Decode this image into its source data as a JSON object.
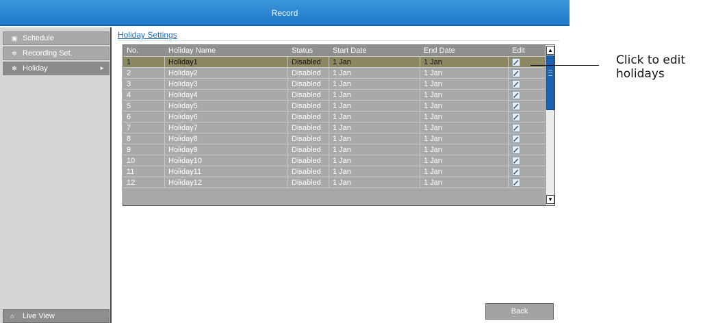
{
  "window": {
    "title": "Record"
  },
  "sidebar": {
    "items": [
      {
        "label": "Schedule",
        "icon": "calendar-icon",
        "active": false
      },
      {
        "label": "Recording Set.",
        "icon": "gear-icon",
        "active": false
      },
      {
        "label": "Holiday",
        "icon": "holiday-icon",
        "active": true,
        "arrow": "►"
      }
    ],
    "live_view": {
      "label": "Live View",
      "icon": "home-icon"
    }
  },
  "main": {
    "section_title": "Holiday Settings",
    "table": {
      "columns": [
        "No.",
        "Holiday Name",
        "Status",
        "Start Date",
        "End Date",
        "Edit"
      ],
      "rows": [
        {
          "no": "1",
          "name": "Holiday1",
          "status": "Disabled",
          "start": "1 Jan",
          "end": "1 Jan"
        },
        {
          "no": "2",
          "name": "Holiday2",
          "status": "Disabled",
          "start": "1 Jan",
          "end": "1 Jan"
        },
        {
          "no": "3",
          "name": "Holiday3",
          "status": "Disabled",
          "start": "1 Jan",
          "end": "1 Jan"
        },
        {
          "no": "4",
          "name": "Holiday4",
          "status": "Disabled",
          "start": "1 Jan",
          "end": "1 Jan"
        },
        {
          "no": "5",
          "name": "Holiday5",
          "status": "Disabled",
          "start": "1 Jan",
          "end": "1 Jan"
        },
        {
          "no": "6",
          "name": "Holiday6",
          "status": "Disabled",
          "start": "1 Jan",
          "end": "1 Jan"
        },
        {
          "no": "7",
          "name": "Holiday7",
          "status": "Disabled",
          "start": "1 Jan",
          "end": "1 Jan"
        },
        {
          "no": "8",
          "name": "Holiday8",
          "status": "Disabled",
          "start": "1 Jan",
          "end": "1 Jan"
        },
        {
          "no": "9",
          "name": "Holiday9",
          "status": "Disabled",
          "start": "1 Jan",
          "end": "1 Jan"
        },
        {
          "no": "10",
          "name": "Holiday10",
          "status": "Disabled",
          "start": "1 Jan",
          "end": "1 Jan"
        },
        {
          "no": "11",
          "name": "Holiday11",
          "status": "Disabled",
          "start": "1 Jan",
          "end": "1 Jan"
        },
        {
          "no": "12",
          "name": "Holiday12",
          "status": "Disabled",
          "start": "1 Jan",
          "end": "1 Jan"
        }
      ],
      "selected_row": 0,
      "edit_icon": "edit-pencil-icon"
    },
    "back_button": "Back"
  },
  "callout": {
    "line1": "Click to edit",
    "line2": "holidays"
  },
  "colors": {
    "titlebar": "#2a88d2",
    "row": "#a9a9a9",
    "selected_row": "#8b8862",
    "scroll_thumb": "#1d5fb0",
    "link": "#1f6fb8"
  }
}
